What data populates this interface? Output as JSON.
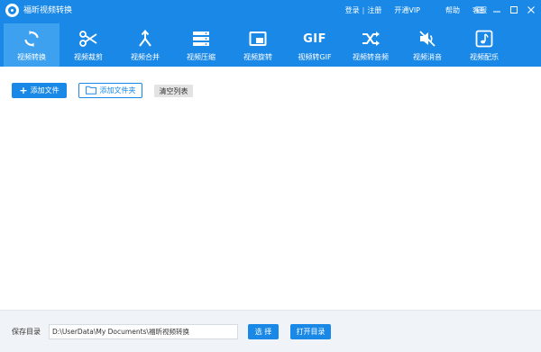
{
  "window": {
    "title": "福昕视频转换"
  },
  "top_links": {
    "login": "登录",
    "separator": "|",
    "register": "注册",
    "vip": "开通VIP",
    "help": "帮助",
    "service": "客服"
  },
  "toolbar": {
    "items": [
      {
        "label": "视频转换",
        "icon": "convert-icon",
        "active": true
      },
      {
        "label": "视频裁剪",
        "icon": "scissors-icon",
        "active": false
      },
      {
        "label": "视频合并",
        "icon": "merge-icon",
        "active": false
      },
      {
        "label": "视频压缩",
        "icon": "compress-icon",
        "active": false
      },
      {
        "label": "视频旋转",
        "icon": "rotate-icon",
        "active": false
      },
      {
        "label": "视频转GIF",
        "icon": "gif-icon",
        "active": false
      },
      {
        "label": "视频转音频",
        "icon": "shuffle-icon",
        "active": false
      },
      {
        "label": "视频消音",
        "icon": "mute-icon",
        "active": false
      },
      {
        "label": "视频配乐",
        "icon": "music-icon",
        "active": false
      }
    ],
    "gif_glyph": "GIF"
  },
  "actions": {
    "add_file": "添加文件",
    "add_plus": "+",
    "add_folder": "添加文件夹",
    "clear_list": "清空列表"
  },
  "footer": {
    "save_label": "保存目录",
    "save_path": "D:\\UserData\\My Documents\\福昕视频转换",
    "select_button": "选 择",
    "open_button": "打开目录"
  },
  "colors": {
    "primary": "#1a88e6",
    "active_tab": "#3da1f0",
    "footer_bg": "#f0f4f8"
  }
}
